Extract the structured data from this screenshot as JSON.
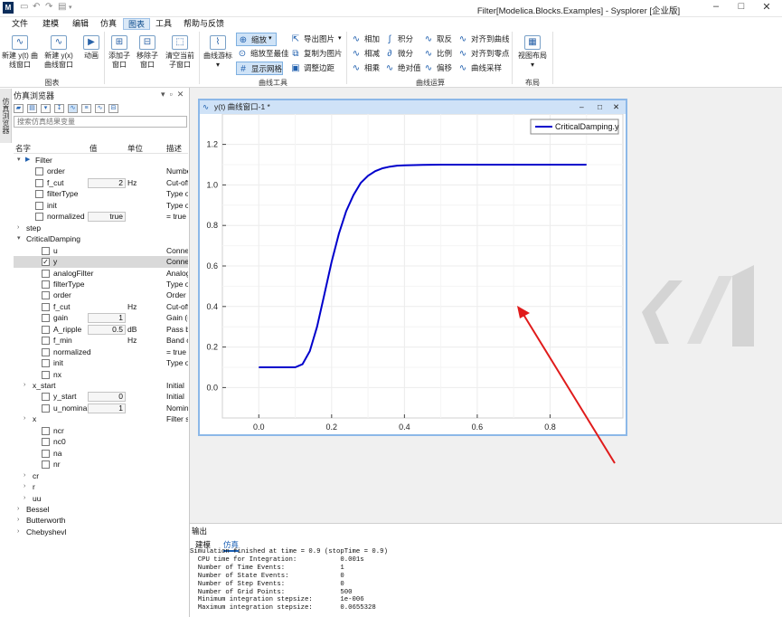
{
  "window": {
    "title": "Filter[Modelica.Blocks.Examples] - Sysplorer [企业版]",
    "logo_text": "M"
  },
  "menu": [
    "文件",
    "建模",
    "编辑",
    "仿真",
    "图表",
    "工具",
    "帮助与反馈"
  ],
  "ribbon": {
    "group1": {
      "name": "图表",
      "buttons": [
        "新建 y(t) 曲线窗口",
        "新建 y(x) 曲线窗口",
        "动画"
      ]
    },
    "group2": {
      "buttons": [
        "添加子窗口",
        "移除子窗口",
        "清空当前子窗口"
      ]
    },
    "group3": {
      "name": "曲线工具",
      "cursor": "曲线游标",
      "col1": [
        "缩放",
        "缩放至最佳",
        "显示网格"
      ],
      "col2": [
        "导出图片",
        "复制为图片",
        "调整边距"
      ]
    },
    "group4": {
      "name": "曲线运算",
      "col1": [
        "相加",
        "相减",
        "相乘"
      ],
      "col2": [
        "积分",
        "微分",
        "绝对值"
      ],
      "col3": [
        "取反",
        "比例",
        "偏移"
      ],
      "col4": [
        "对齐到曲线",
        "对齐到零点",
        "曲线采样"
      ]
    },
    "group5": {
      "name": "布局",
      "button": "视图布局"
    }
  },
  "browser": {
    "vertical_tab": "仿真浏览器",
    "title": "仿真浏览器",
    "search_placeholder": "搜索仿真结果变量",
    "columns": [
      "名字",
      "值",
      "单位",
      "描述"
    ],
    "rows": [
      {
        "indent": 0,
        "arrow": "▾",
        "icon": true,
        "name": "Filter",
        "desc": ""
      },
      {
        "indent": 1,
        "cb": "",
        "name": "order",
        "desc": "Number"
      },
      {
        "indent": 1,
        "cb": "",
        "name": "f_cut",
        "val": "2",
        "unit": "Hz",
        "desc": "Cut-off"
      },
      {
        "indent": 1,
        "cb": "",
        "name": "filterType",
        "desc": "Type of"
      },
      {
        "indent": 1,
        "cb": "",
        "name": "init",
        "desc": "Type of"
      },
      {
        "indent": 1,
        "cb": "",
        "name": "normalized",
        "val": "true",
        "desc": "= true"
      },
      {
        "indent": 0,
        "arrow": "›",
        "name": "step",
        "desc": ""
      },
      {
        "indent": 0,
        "arrow": "▾",
        "name": "CriticalDamping",
        "desc": ""
      },
      {
        "indent": 2,
        "cb": "",
        "name": "u",
        "desc": "Connec"
      },
      {
        "indent": 2,
        "cb": "✓",
        "name": "y",
        "desc": "Connec",
        "hl": true
      },
      {
        "indent": 2,
        "cb": "",
        "name": "analogFilter",
        "desc": "Analog"
      },
      {
        "indent": 2,
        "cb": "",
        "name": "filterType",
        "desc": "Type of"
      },
      {
        "indent": 2,
        "cb": "",
        "name": "order",
        "desc": "Order"
      },
      {
        "indent": 2,
        "cb": "",
        "name": "f_cut",
        "unit": "Hz",
        "desc": "Cut-off"
      },
      {
        "indent": 2,
        "cb": "",
        "name": "gain",
        "val": "1",
        "desc": "Gain (="
      },
      {
        "indent": 2,
        "cb": "",
        "name": "A_ripple",
        "val": "0.5",
        "unit": "dB",
        "desc": "Pass b"
      },
      {
        "indent": 2,
        "cb": "",
        "name": "f_min",
        "unit": "Hz",
        "desc": "Band c"
      },
      {
        "indent": 2,
        "cb": "",
        "name": "normalized",
        "desc": "= true"
      },
      {
        "indent": 2,
        "cb": "",
        "name": "init",
        "desc": "Type of"
      },
      {
        "indent": 2,
        "cb": "",
        "name": "nx",
        "desc": ""
      },
      {
        "indent": 1,
        "arrow": "›",
        "name": "x_start",
        "desc": "Initial"
      },
      {
        "indent": 2,
        "cb": "",
        "name": "y_start",
        "val": "0",
        "desc": "Initial"
      },
      {
        "indent": 2,
        "cb": "",
        "name": "u_nominal",
        "val": "1",
        "desc": "Nomin"
      },
      {
        "indent": 1,
        "arrow": "›",
        "name": "x",
        "desc": "Filter s"
      },
      {
        "indent": 2,
        "cb": "",
        "name": "ncr",
        "desc": ""
      },
      {
        "indent": 2,
        "cb": "",
        "name": "nc0",
        "desc": ""
      },
      {
        "indent": 2,
        "cb": "",
        "name": "na",
        "desc": ""
      },
      {
        "indent": 2,
        "cb": "",
        "name": "nr",
        "desc": ""
      },
      {
        "indent": 1,
        "arrow": "›",
        "name": "cr",
        "desc": ""
      },
      {
        "indent": 1,
        "arrow": "›",
        "name": "r",
        "desc": ""
      },
      {
        "indent": 1,
        "arrow": "›",
        "name": "uu",
        "desc": ""
      },
      {
        "indent": 0,
        "arrow": "›",
        "name": "Bessel",
        "desc": ""
      },
      {
        "indent": 0,
        "arrow": "›",
        "name": "Butterworth",
        "desc": ""
      },
      {
        "indent": 0,
        "arrow": "›",
        "name": "Chebyshevl",
        "desc": ""
      }
    ]
  },
  "plot_window": {
    "title": "y(t) 曲线窗口-1 *"
  },
  "chart_data": {
    "type": "line",
    "title": "",
    "xlabel": "",
    "ylabel": "",
    "xlim": [
      -0.1,
      1.0
    ],
    "ylim": [
      -0.15,
      1.35
    ],
    "xticks": [
      "0.0",
      "0.2",
      "0.4",
      "0.6",
      "0.8"
    ],
    "yticks": [
      "0.0",
      "0.2",
      "0.4",
      "0.6",
      "0.8",
      "1.0",
      "1.2"
    ],
    "grid": true,
    "legend": "top-right",
    "series": [
      {
        "name": "CriticalDamping.y",
        "color": "#0000cc",
        "x": [
          0.0,
          0.05,
          0.1,
          0.12,
          0.14,
          0.16,
          0.18,
          0.2,
          0.22,
          0.24,
          0.26,
          0.28,
          0.3,
          0.32,
          0.34,
          0.36,
          0.38,
          0.4,
          0.45,
          0.5,
          0.55,
          0.6,
          0.7,
          0.8,
          0.9
        ],
        "y": [
          0.1,
          0.1,
          0.1,
          0.115,
          0.18,
          0.3,
          0.46,
          0.62,
          0.76,
          0.87,
          0.95,
          1.01,
          1.045,
          1.068,
          1.082,
          1.09,
          1.095,
          1.097,
          1.099,
          1.1,
          1.1,
          1.1,
          1.1,
          1.1,
          1.1
        ]
      }
    ]
  },
  "output": {
    "title": "输出",
    "tabs": [
      "建模",
      "仿真"
    ],
    "lines": [
      "Simulation finished at time = 0.9 (stopTime = 0.9)",
      "  CPU time for Integration:           0.001s",
      "  Number of Time Events:              1",
      "  Number of State Events:             0",
      "  Number of Step Events:              0",
      "  Number of Grid Points:              500",
      "  Minimum integration stepsize:       1e-006",
      "  Maximum integration stepsize:       0.0655328"
    ]
  }
}
